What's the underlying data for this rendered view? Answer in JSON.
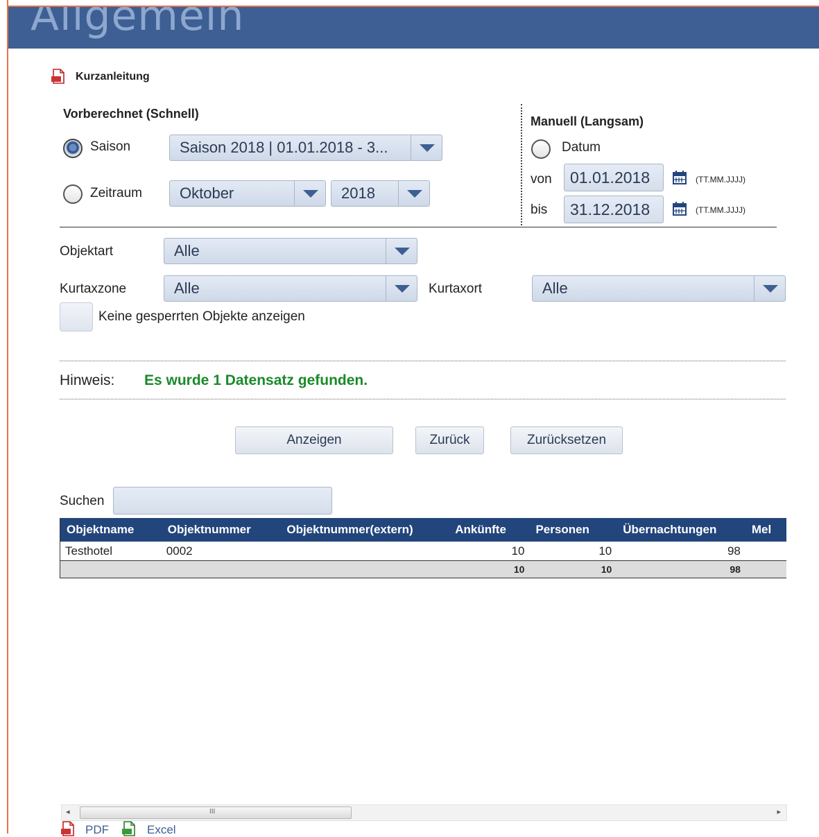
{
  "header": {
    "title": "Allgemein"
  },
  "guide": {
    "label": "Kurzanleitung",
    "icon": "pdf-icon"
  },
  "precalc": {
    "heading": "Vorberechnet (Schnell)",
    "season_label": "Saison",
    "season_value": "Saison 2018 | 01.01.2018 - 3...",
    "period_label": "Zeitraum",
    "month_value": "Oktober",
    "year_value": "2018"
  },
  "manual": {
    "heading": "Manuell (Langsam)",
    "date_label": "Datum",
    "from_label": "von",
    "from_value": "01.01.2018",
    "to_label": "bis",
    "to_value": "31.12.2018",
    "format_hint": "(TT.MM.JJJJ)"
  },
  "filters": {
    "object_type_label": "Objektart",
    "object_type_value": "Alle",
    "zone_label": "Kurtaxzone",
    "zone_value": "Alle",
    "place_label": "Kurtaxort",
    "place_value": "Alle",
    "hide_locked_label": "Keine gesperrten Objekte anzeigen"
  },
  "notice": {
    "label": "Hinweis:",
    "message": "Es wurde 1 Datensatz gefunden.",
    "message_color": "#1a8a2a"
  },
  "buttons": {
    "show": "Anzeigen",
    "back": "Zurück",
    "reset": "Zurücksetzen"
  },
  "search": {
    "label": "Suchen",
    "value": ""
  },
  "table": {
    "columns": [
      "Objektname",
      "Objektnummer",
      "Objektnummer(extern)",
      "Ankünfte",
      "Personen",
      "Übernachtungen",
      "Mel"
    ],
    "row": {
      "name": "Testhotel",
      "number": "0002",
      "external": "",
      "arrivals": "10",
      "persons": "10",
      "nights": "98"
    },
    "totals": {
      "arrivals": "10",
      "persons": "10",
      "nights": "98"
    }
  },
  "scroll": {
    "left_arrow": "◂",
    "grip": "III",
    "right_arrow": "▸"
  },
  "exports": {
    "pdf": "PDF",
    "excel": "Excel"
  },
  "colors": {
    "header_bg": "#3d5f93",
    "table_header_bg": "#22457c",
    "frame_accent": "#e8734b"
  }
}
